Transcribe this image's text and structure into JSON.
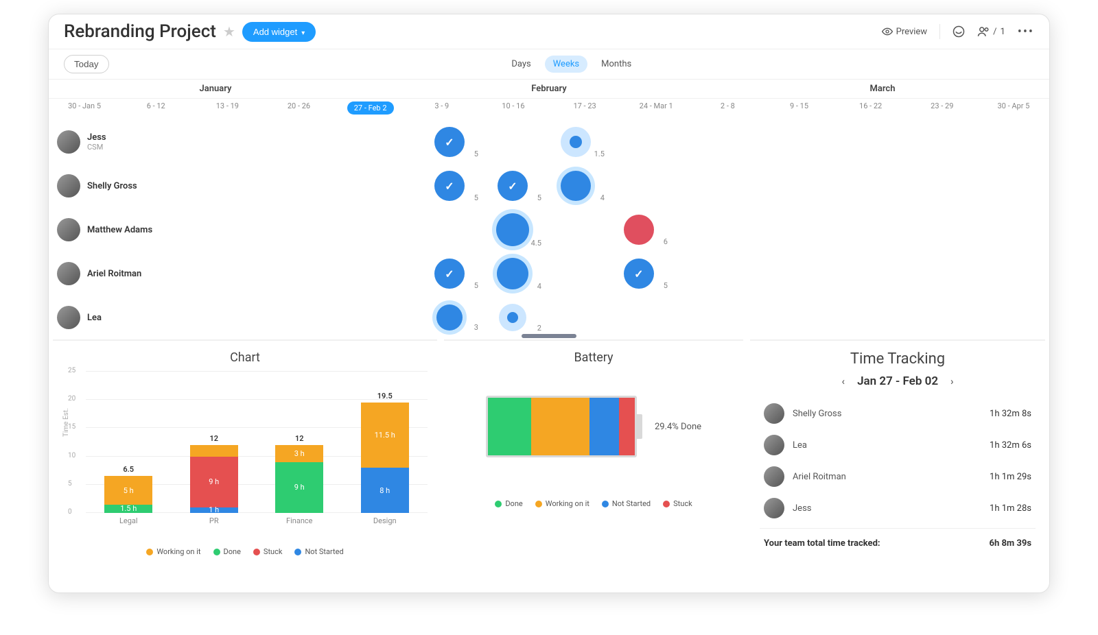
{
  "header": {
    "title": "Rebranding Project",
    "add_widget": "Add widget",
    "preview": "Preview",
    "people_count": "1"
  },
  "viewbar": {
    "today": "Today",
    "tabs": {
      "days": "Days",
      "weeks": "Weeks",
      "months": "Months"
    }
  },
  "timeline": {
    "months": [
      "January",
      "February",
      "March"
    ],
    "weeks": [
      "30 - Jan 5",
      "6 - 12",
      "13 - 19",
      "20 - 26",
      "27 - Feb 2",
      "3 - 9",
      "10 - 16",
      "17 - 23",
      "24 - Mar 1",
      "2 - 8",
      "9 - 15",
      "16 - 22",
      "23 - 29",
      "30 - Apr 5"
    ],
    "current_week_index": 4,
    "rows": [
      {
        "name": "Jess",
        "role": "CSM",
        "cells": [
          {
            "col": 4,
            "kind": "check",
            "size": 44,
            "val": "5"
          },
          {
            "col": 6,
            "kind": "halo",
            "haloSize": 44,
            "dotSize": 18,
            "val": "1.5"
          }
        ]
      },
      {
        "name": "Shelly Gross",
        "role": "",
        "cells": [
          {
            "col": 4,
            "kind": "check",
            "size": 44,
            "val": "5"
          },
          {
            "col": 5,
            "kind": "check",
            "size": 44,
            "val": "5"
          },
          {
            "col": 6,
            "kind": "solid",
            "size": 44,
            "ring": true,
            "val": "4"
          }
        ]
      },
      {
        "name": "Matthew Adams",
        "role": "",
        "cells": [
          {
            "col": 5,
            "kind": "solid",
            "size": 48,
            "ring": true,
            "val": "4.5"
          },
          {
            "col": 7,
            "kind": "red",
            "size": 44,
            "val": "6"
          }
        ]
      },
      {
        "name": "Ariel Roitman",
        "role": "",
        "cells": [
          {
            "col": 4,
            "kind": "check",
            "size": 44,
            "val": "5"
          },
          {
            "col": 5,
            "kind": "solid",
            "size": 46,
            "ring": true,
            "val": "4"
          },
          {
            "col": 7,
            "kind": "check",
            "size": 44,
            "val": "5"
          }
        ]
      },
      {
        "name": "Lea",
        "role": "",
        "cells": [
          {
            "col": 4,
            "kind": "solid",
            "size": 38,
            "ring": true,
            "val": "3"
          },
          {
            "col": 5,
            "kind": "halo",
            "haloSize": 40,
            "dotSize": 16,
            "val": "2"
          }
        ]
      }
    ]
  },
  "chart": {
    "title": "Chart"
  },
  "chart_data": {
    "type": "bar",
    "title": "Chart",
    "ylabel": "Time Est.",
    "ylim": [
      0,
      25
    ],
    "ticks": [
      0,
      5,
      10,
      15,
      20,
      25
    ],
    "categories": [
      "Legal",
      "PR",
      "Finance",
      "Design"
    ],
    "series": [
      {
        "name": "Done",
        "color": "#2ecc71",
        "values": [
          1.5,
          0,
          9,
          0
        ],
        "labels": [
          "1.5 h",
          "",
          "9 h",
          ""
        ]
      },
      {
        "name": "Not Started",
        "color": "#2f87e3",
        "values": [
          0,
          1,
          0,
          8
        ],
        "labels": [
          "",
          "1 h",
          "",
          "8 h"
        ]
      },
      {
        "name": "Stuck",
        "color": "#e55050",
        "values": [
          0,
          9,
          0,
          0
        ],
        "labels": [
          "",
          "9 h",
          "",
          ""
        ]
      },
      {
        "name": "Working on it",
        "color": "#f5a623",
        "values": [
          5,
          2,
          3,
          11.5
        ],
        "labels": [
          "5 h",
          "",
          "3 h",
          "11.5 h"
        ]
      }
    ],
    "totals": [
      6.5,
      12,
      12,
      19.5
    ],
    "legend_order": [
      "Working on it",
      "Done",
      "Stuck",
      "Not Started"
    ],
    "legend_colors": {
      "Working on it": "#f5a623",
      "Done": "#2ecc71",
      "Stuck": "#e55050",
      "Not Started": "#2f87e3"
    }
  },
  "battery": {
    "title": "Battery",
    "label": "29.4% Done",
    "segments": [
      {
        "name": "Done",
        "pct": 29.4,
        "color": "#2ecc71"
      },
      {
        "name": "Working on it",
        "pct": 40,
        "color": "#f5a623"
      },
      {
        "name": "Not Started",
        "pct": 20,
        "color": "#2f87e3"
      },
      {
        "name": "Stuck",
        "pct": 10.6,
        "color": "#e55050"
      }
    ],
    "legend": [
      "Done",
      "Working on it",
      "Not Started",
      "Stuck"
    ]
  },
  "time_tracking": {
    "title": "Time Tracking",
    "range": "Jan 27 - Feb 02",
    "rows": [
      {
        "name": "Shelly Gross",
        "time": "1h 32m 8s"
      },
      {
        "name": "Lea",
        "time": "1h 32m 6s"
      },
      {
        "name": "Ariel Roitman",
        "time": "1h 1m 29s"
      },
      {
        "name": "Jess",
        "time": "1h 1m 28s"
      }
    ],
    "total_label": "Your team total time tracked:",
    "total_time": "6h 8m 39s"
  }
}
